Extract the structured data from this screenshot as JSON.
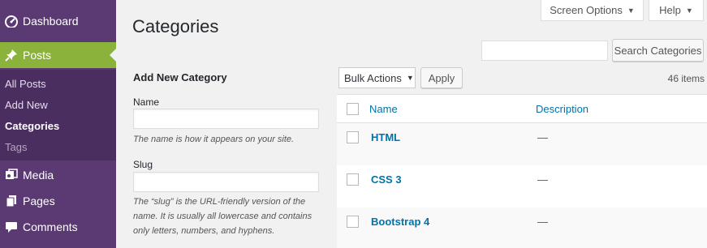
{
  "sidebar": {
    "dashboard": "Dashboard",
    "posts": "Posts",
    "submenu": [
      "All Posts",
      "Add New",
      "Categories",
      "Tags"
    ],
    "media": "Media",
    "pages": "Pages",
    "comments": "Comments"
  },
  "tabs": {
    "screen_options": "Screen Options",
    "help": "Help"
  },
  "page_title": "Categories",
  "search": {
    "button": "Search Categories",
    "value": ""
  },
  "form": {
    "heading": "Add New Category",
    "name_label": "Name",
    "name_desc": "The name is how it appears on your site.",
    "slug_label": "Slug",
    "slug_desc": "The “slug” is the URL-friendly version of the name. It is usually all lowercase and contains only letters, numbers, and hyphens."
  },
  "table": {
    "bulk_actions": "Bulk Actions",
    "apply": "Apply",
    "count": "46 items",
    "col_name": "Name",
    "col_description": "Description",
    "rows": [
      {
        "name": "HTML",
        "description": "—"
      },
      {
        "name": "CSS 3",
        "description": "—"
      },
      {
        "name": "Bootstrap 4",
        "description": "—"
      }
    ]
  },
  "colors": {
    "sidebar_bg": "#5b3a74",
    "submenu_bg": "#4b2e60",
    "active_menu": "#8bb33b",
    "link": "#0073aa"
  }
}
